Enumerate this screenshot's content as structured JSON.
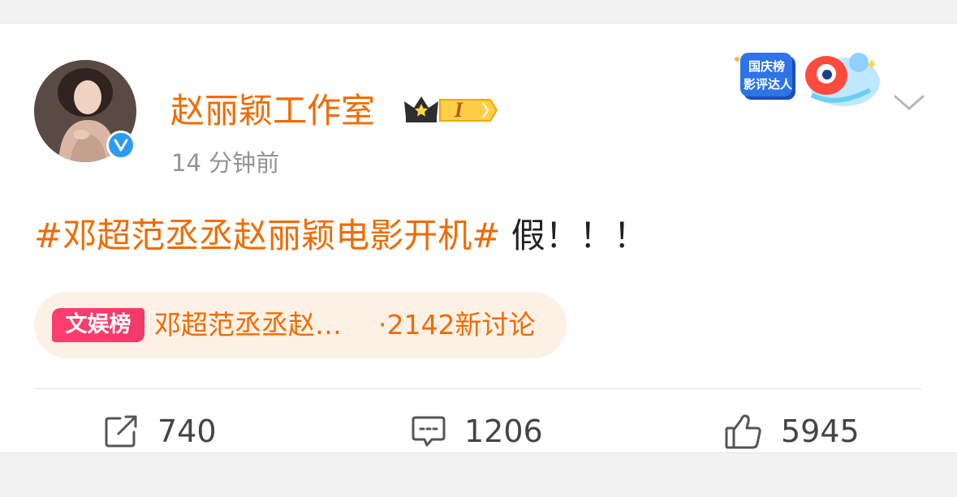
{
  "post": {
    "author_name": "赵丽颖工作室",
    "timestamp": "14 分钟前",
    "hashtag": "#邓超范丞丞赵丽颖电影开机#",
    "text": " 假！！！",
    "member_level": "I",
    "promo_badge_lines": [
      "国庆榜",
      "影评达人"
    ]
  },
  "topic": {
    "tag_label": "文娱榜",
    "title": "邓超范丞丞赵…",
    "discussion_count": "·2142新讨论"
  },
  "actions": {
    "repost_count": "740",
    "comment_count": "1206",
    "like_count": "5945"
  },
  "colors": {
    "accent_orange": "#f06b00",
    "verified_blue": "#2b9af3",
    "tag_pink": "#ff3f6f",
    "pill_background": "#fdf1e6"
  },
  "icons": [
    "verified-icon",
    "crown-icon",
    "chevron-down-icon",
    "repost-icon",
    "comment-icon",
    "like-icon"
  ]
}
